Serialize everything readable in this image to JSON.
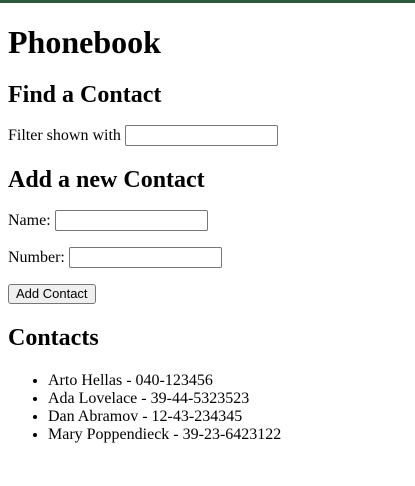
{
  "app": {
    "title": "Phonebook"
  },
  "find": {
    "heading": "Find a Contact",
    "filter_label": "Filter shown with",
    "filter_value": ""
  },
  "add": {
    "heading": "Add a new Contact",
    "name_label": "Name:",
    "name_value": "",
    "number_label": "Number:",
    "number_value": "",
    "submit_label": "Add Contact"
  },
  "contacts": {
    "heading": "Contacts",
    "items": [
      {
        "text": "Arto Hellas - 040-123456"
      },
      {
        "text": "Ada Lovelace - 39-44-5323523"
      },
      {
        "text": "Dan Abramov - 12-43-234345"
      },
      {
        "text": "Mary Poppendieck - 39-23-6423122"
      }
    ]
  },
  "colors": {
    "top_bar": "#2d5a3a"
  }
}
